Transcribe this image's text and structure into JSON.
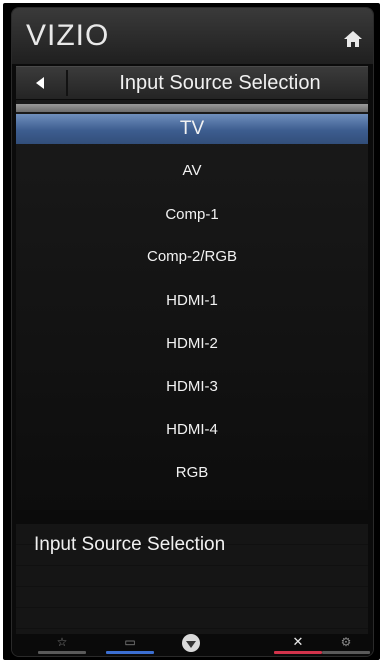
{
  "brand": {
    "logo_text": "VIZIO"
  },
  "header": {
    "title": "Input Source Selection"
  },
  "inputs": [
    {
      "label": "TV",
      "selected": true
    },
    {
      "label": "AV",
      "selected": false
    },
    {
      "label": "Comp-1",
      "selected": false
    },
    {
      "label": "Comp-2/RGB",
      "selected": false
    },
    {
      "label": "HDMI-1",
      "selected": false
    },
    {
      "label": "HDMI-2",
      "selected": false
    },
    {
      "label": "HDMI-3",
      "selected": false
    },
    {
      "label": "HDMI-4",
      "selected": false
    },
    {
      "label": "RGB",
      "selected": false
    }
  ],
  "info": {
    "title": "Input Source Selection"
  },
  "bottom_bar": {
    "buttons": [
      {
        "icon": "star-icon",
        "accent": "#5a5a5a"
      },
      {
        "icon": "screen-icon",
        "accent": "#3c6fd1"
      },
      {
        "icon": "vizio-v-icon",
        "accent": "#d9d9d9"
      },
      {
        "icon": "close-icon",
        "accent": "#d2334b"
      },
      {
        "icon": "gear-icon",
        "accent": "#5a5a5a"
      }
    ]
  },
  "colors": {
    "selected_row": "#4a6a9c",
    "background": "#0b0b0b"
  }
}
